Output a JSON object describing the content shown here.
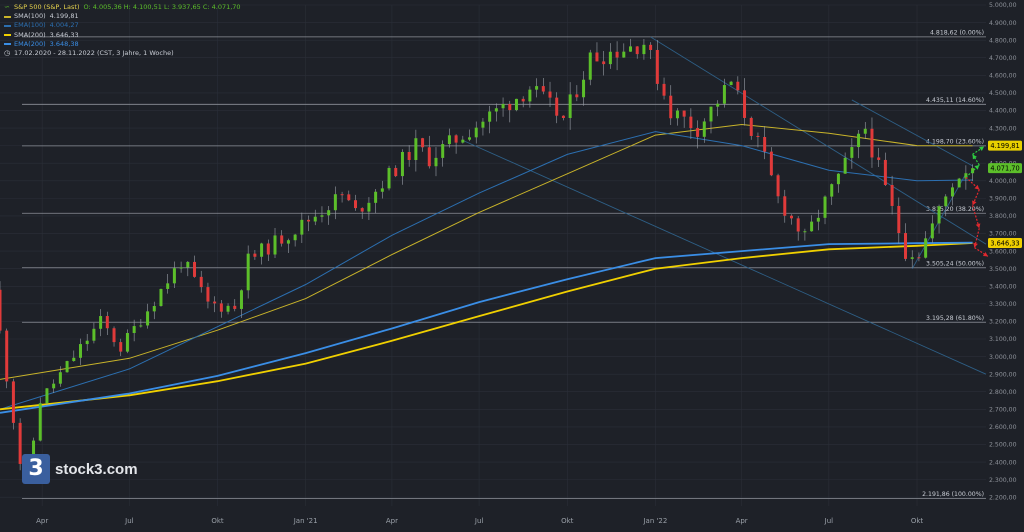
{
  "header": {
    "title": "S&P 500 (S&P, Last)",
    "ohlc": "O: 4.005,36  H: 4.100,51  L: 3.937,65  C: 4.071,70",
    "period": "17.02.2020 - 28.11.2022  (CST, 3 Jahre, 1 Woche)"
  },
  "legend": [
    {
      "label": "SMA(100)",
      "value": "4.199,81",
      "color": "#c9b42a"
    },
    {
      "label": "EMA(100)",
      "value": "4.004,27",
      "color": "#2c6fb0"
    },
    {
      "label": "SMA(200)",
      "value": "3.646,33",
      "color": "#f0d000"
    },
    {
      "label": "EMA(200)",
      "value": "3.648,38",
      "color": "#3a8ee6"
    }
  ],
  "logo": {
    "mark": "3",
    "text": "stock3.com"
  },
  "colors": {
    "background": "#1e2128",
    "grid": "#2b2f38",
    "fib": "#8d9199",
    "up": "#5cbf2a",
    "down": "#e03a3a",
    "sma100": "#c9b42a",
    "ema100": "#2c6fb0",
    "sma200": "#f0d000",
    "ema200": "#3a8ee6",
    "trend": "#2e5f86"
  },
  "chart_data": {
    "type": "candlestick",
    "y_range": [
      2150,
      5000
    ],
    "y_ticks": [
      "5.000,00",
      "4.900,00",
      "4.800,00",
      "4.700,00",
      "4.600,00",
      "4.500,00",
      "4.400,00",
      "4.300,00",
      "4.200,00",
      "4.100,00",
      "4.000,00",
      "3.900,00",
      "3.800,00",
      "3.700,00",
      "3.600,00",
      "3.500,00",
      "3.400,00",
      "3.300,00",
      "3.200,00",
      "3.100,00",
      "3.000,00",
      "2.900,00",
      "2.800,00",
      "2.700,00",
      "2.600,00",
      "2.500,00",
      "2.400,00",
      "2.300,00",
      "2.200,00"
    ],
    "y_tick_values": [
      5000,
      4900,
      4800,
      4700,
      4600,
      4500,
      4400,
      4300,
      4200,
      4100,
      4000,
      3900,
      3800,
      3700,
      3600,
      3500,
      3400,
      3300,
      3200,
      3100,
      3000,
      2900,
      2800,
      2700,
      2600,
      2500,
      2400,
      2300,
      2200
    ],
    "x_range": [
      "2020-02-17",
      "2022-12-12"
    ],
    "x_labels": [
      {
        "date": "2020-04-01",
        "label": "Apr"
      },
      {
        "date": "2020-07-01",
        "label": "Jul"
      },
      {
        "date": "2020-10-01",
        "label": "Okt"
      },
      {
        "date": "2021-01-01",
        "label": "Jan '21"
      },
      {
        "date": "2021-04-01",
        "label": "Apr"
      },
      {
        "date": "2021-07-01",
        "label": "Jul"
      },
      {
        "date": "2021-10-01",
        "label": "Okt"
      },
      {
        "date": "2022-01-01",
        "label": "Jan '22"
      },
      {
        "date": "2022-04-01",
        "label": "Apr"
      },
      {
        "date": "2022-07-01",
        "label": "Jul"
      },
      {
        "date": "2022-10-01",
        "label": "Okt"
      }
    ],
    "fib_levels": [
      {
        "value": 4818.62,
        "label": "4.818,62 (0.00%)"
      },
      {
        "value": 4435.11,
        "label": "4.435,11 (14.60%)"
      },
      {
        "value": 4198.7,
        "label": "4.198,70 (23.60%)"
      },
      {
        "value": 3815.2,
        "label": "3.815,20 (38.20%)"
      },
      {
        "value": 3505.24,
        "label": "3.505,24 (50.00%)"
      },
      {
        "value": 3195.28,
        "label": "3.195,28 (61.80%)"
      },
      {
        "value": 2191.86,
        "label": "2.191,86 (100.00%)"
      }
    ],
    "price_tags": [
      {
        "value": 4199.81,
        "label": "4.199,81",
        "color": "#e8d000",
        "text_color": "#000000"
      },
      {
        "value": 4071.7,
        "label": "4.071,70",
        "color": "#5cbf2a",
        "text_color": "#000000"
      },
      {
        "value": 3646.33,
        "label": "3.646,33",
        "color": "#f0d000",
        "text_color": "#000000"
      }
    ],
    "anchors": [
      {
        "date": "2020-02-17",
        "value": 3380
      },
      {
        "date": "2020-03-16",
        "value": 2400
      },
      {
        "date": "2020-03-23",
        "value": 2300
      },
      {
        "date": "2020-04-06",
        "value": 2750
      },
      {
        "date": "2020-06-08",
        "value": 3200
      },
      {
        "date": "2020-06-29",
        "value": 3050
      },
      {
        "date": "2020-09-01",
        "value": 3550
      },
      {
        "date": "2020-09-28",
        "value": 3300
      },
      {
        "date": "2020-10-26",
        "value": 3280
      },
      {
        "date": "2020-11-09",
        "value": 3550
      },
      {
        "date": "2021-01-04",
        "value": 3750
      },
      {
        "date": "2021-02-15",
        "value": 3920
      },
      {
        "date": "2021-03-01",
        "value": 3820
      },
      {
        "date": "2021-05-03",
        "value": 4200
      },
      {
        "date": "2021-05-17",
        "value": 4130
      },
      {
        "date": "2021-08-30",
        "value": 4530
      },
      {
        "date": "2021-10-04",
        "value": 4350
      },
      {
        "date": "2021-11-01",
        "value": 4700
      },
      {
        "date": "2021-12-27",
        "value": 4790
      },
      {
        "date": "2022-01-24",
        "value": 4400
      },
      {
        "date": "2022-02-21",
        "value": 4300
      },
      {
        "date": "2022-03-28",
        "value": 4560
      },
      {
        "date": "2022-05-02",
        "value": 4120
      },
      {
        "date": "2022-05-16",
        "value": 3900
      },
      {
        "date": "2022-06-13",
        "value": 3670
      },
      {
        "date": "2022-08-15",
        "value": 4300
      },
      {
        "date": "2022-09-26",
        "value": 3600
      },
      {
        "date": "2022-10-10",
        "value": 3590
      },
      {
        "date": "2022-11-14",
        "value": 3990
      },
      {
        "date": "2022-11-28",
        "value": 4071.7
      }
    ],
    "lines": [
      {
        "name": "SMA(100)",
        "color": "#c9b42a",
        "width": 1,
        "points": [
          {
            "date": "2020-02-17",
            "value": 2870
          },
          {
            "date": "2020-07-01",
            "value": 2990
          },
          {
            "date": "2020-10-01",
            "value": 3150
          },
          {
            "date": "2021-01-01",
            "value": 3330
          },
          {
            "date": "2021-04-01",
            "value": 3580
          },
          {
            "date": "2021-07-01",
            "value": 3820
          },
          {
            "date": "2021-10-01",
            "value": 4040
          },
          {
            "date": "2022-01-01",
            "value": 4260
          },
          {
            "date": "2022-04-01",
            "value": 4320
          },
          {
            "date": "2022-07-01",
            "value": 4270
          },
          {
            "date": "2022-10-01",
            "value": 4200
          },
          {
            "date": "2022-11-28",
            "value": 4199.81
          }
        ]
      },
      {
        "name": "EMA(100)",
        "color": "#2c6fb0",
        "width": 1,
        "points": [
          {
            "date": "2020-02-17",
            "value": 2700
          },
          {
            "date": "2020-07-01",
            "value": 2930
          },
          {
            "date": "2020-10-01",
            "value": 3170
          },
          {
            "date": "2021-01-01",
            "value": 3410
          },
          {
            "date": "2021-04-01",
            "value": 3690
          },
          {
            "date": "2021-07-01",
            "value": 3930
          },
          {
            "date": "2021-10-01",
            "value": 4150
          },
          {
            "date": "2022-01-01",
            "value": 4280
          },
          {
            "date": "2022-04-01",
            "value": 4200
          },
          {
            "date": "2022-07-01",
            "value": 4060
          },
          {
            "date": "2022-10-01",
            "value": 4000
          },
          {
            "date": "2022-11-28",
            "value": 4004.27
          }
        ]
      },
      {
        "name": "SMA(200)",
        "color": "#f0d000",
        "width": 1.8,
        "points": [
          {
            "date": "2020-02-17",
            "value": 2700
          },
          {
            "date": "2020-07-01",
            "value": 2780
          },
          {
            "date": "2020-10-01",
            "value": 2860
          },
          {
            "date": "2021-01-01",
            "value": 2960
          },
          {
            "date": "2021-04-01",
            "value": 3090
          },
          {
            "date": "2021-07-01",
            "value": 3230
          },
          {
            "date": "2021-10-01",
            "value": 3370
          },
          {
            "date": "2022-01-01",
            "value": 3500
          },
          {
            "date": "2022-04-01",
            "value": 3560
          },
          {
            "date": "2022-07-01",
            "value": 3610
          },
          {
            "date": "2022-10-01",
            "value": 3630
          },
          {
            "date": "2022-11-28",
            "value": 3646.33
          }
        ]
      },
      {
        "name": "EMA(200)",
        "color": "#3a8ee6",
        "width": 1.8,
        "points": [
          {
            "date": "2020-02-17",
            "value": 2680
          },
          {
            "date": "2020-07-01",
            "value": 2790
          },
          {
            "date": "2020-10-01",
            "value": 2890
          },
          {
            "date": "2021-01-01",
            "value": 3020
          },
          {
            "date": "2021-04-01",
            "value": 3160
          },
          {
            "date": "2021-07-01",
            "value": 3310
          },
          {
            "date": "2021-10-01",
            "value": 3440
          },
          {
            "date": "2022-01-01",
            "value": 3560
          },
          {
            "date": "2022-04-01",
            "value": 3600
          },
          {
            "date": "2022-07-01",
            "value": 3640
          },
          {
            "date": "2022-10-01",
            "value": 3645
          },
          {
            "date": "2022-11-28",
            "value": 3648.38
          }
        ]
      }
    ],
    "trend_lines": [
      {
        "from": {
          "date": "2021-12-27",
          "value": 4818
        },
        "to": {
          "date": "2022-12-12",
          "value": 3640
        }
      },
      {
        "from": {
          "date": "2021-06-14",
          "value": 4230
        },
        "to": {
          "date": "2022-12-12",
          "value": 2900
        }
      },
      {
        "from": {
          "date": "2022-09-26",
          "value": 3500
        },
        "to": {
          "date": "2022-11-21",
          "value": 4040
        }
      },
      {
        "from": {
          "date": "2022-07-25",
          "value": 4460
        },
        "to": {
          "date": "2022-11-28",
          "value": 4085
        }
      }
    ],
    "scenario_up": [
      {
        "from": {
          "date": "2022-11-21",
          "value": 4020
        },
        "to": {
          "date": "2022-12-05",
          "value": 4090
        }
      },
      {
        "from": {
          "date": "2022-12-05",
          "value": 4090
        },
        "to": {
          "date": "2022-11-28",
          "value": 4150
        }
      },
      {
        "from": {
          "date": "2022-11-28",
          "value": 4150
        },
        "to": {
          "date": "2022-12-10",
          "value": 4195
        }
      }
    ],
    "scenario_down": [
      {
        "from": {
          "date": "2022-11-21",
          "value": 4020
        },
        "to": {
          "date": "2022-12-05",
          "value": 3950
        }
      },
      {
        "from": {
          "date": "2022-12-05",
          "value": 3950
        },
        "to": {
          "date": "2022-11-28",
          "value": 3860
        }
      },
      {
        "from": {
          "date": "2022-11-28",
          "value": 3860
        },
        "to": {
          "date": "2022-12-05",
          "value": 3730
        }
      },
      {
        "from": {
          "date": "2022-12-05",
          "value": 3730
        },
        "to": {
          "date": "2022-11-30",
          "value": 3620
        }
      },
      {
        "from": {
          "date": "2022-11-30",
          "value": 3620
        },
        "to": {
          "date": "2022-12-14",
          "value": 3570
        }
      }
    ]
  }
}
